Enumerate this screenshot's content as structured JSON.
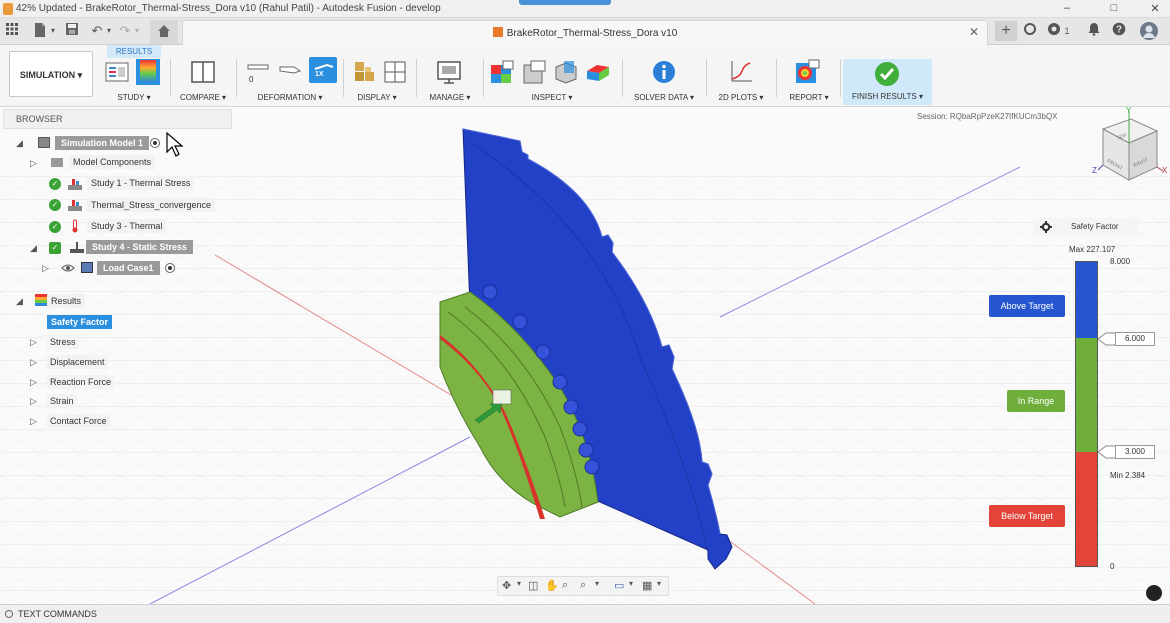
{
  "window": {
    "title": "42% Updated - BrakeRotor_Thermal-Stress_Dora v10 (Rahul Patil) - Autodesk Fusion - develop",
    "minimize": "–",
    "maximize": "□",
    "close": "✕"
  },
  "tabbar": {
    "document_tab": "BrakeRotor_Thermal-Stress_Dora v10",
    "tab_close": "✕",
    "job_count": "1"
  },
  "toolbar": {
    "workspace": "SIMULATION ▾",
    "active_tab": "RESULTS",
    "groups": {
      "study": "STUDY ▾",
      "compare": "COMPARE ▾",
      "deformation": "DEFORMATION ▾",
      "display": "DISPLAY ▾",
      "manage": "MANAGE ▾",
      "inspect": "INSPECT ▾",
      "solver_data": "SOLVER DATA ▾",
      "plots_2d": "2D PLOTS ▾",
      "report": "REPORT ▾",
      "finish_results": "FINISH RESULTS ▾"
    },
    "deformation_value": "0",
    "deformation_scale": "1X"
  },
  "browser": {
    "header": "BROWSER",
    "model": "Simulation Model 1",
    "model_components": "Model Components",
    "studies": [
      "Study 1 - Thermal Stress",
      "Thermal_Stress_convergence",
      "Study 3 - Thermal"
    ],
    "active_study": "Study 4 - Static Stress",
    "load_case": "Load Case1",
    "results": "Results",
    "results_items": {
      "selected": "Safety Factor",
      "others": [
        "Stress",
        "Displacement",
        "Reaction Force",
        "Strain",
        "Contact Force"
      ]
    }
  },
  "viewport": {
    "session": "Session: RQbaRpPzeK27IfKUCm3bQX",
    "viewcube": {
      "top": "TOP",
      "front": "FRONT",
      "right": "RIGHT",
      "axis_x": "X",
      "axis_y": "Y",
      "axis_z": "Z"
    }
  },
  "legend": {
    "title": "Safety Factor",
    "max_label": "Max 227.107",
    "min_label": "Min 2.384",
    "tick_top": "8.000",
    "tick_bottom": "0",
    "upper_target": "6.000",
    "lower_target": "3.000",
    "above_target": "Above Target",
    "in_range": "In Range",
    "below_target": "Below Target",
    "colors": {
      "above": "#2656cf",
      "in_range": "#6fae3a",
      "below": "#e2443a"
    }
  },
  "statusbar": {
    "text_commands": "TEXT COMMANDS"
  },
  "icons": {
    "grid": "grid-icon",
    "file": "file-icon",
    "save": "save-icon",
    "undo": "undo-icon",
    "redo": "redo-icon",
    "home": "home-icon",
    "gear": "gear-icon"
  }
}
